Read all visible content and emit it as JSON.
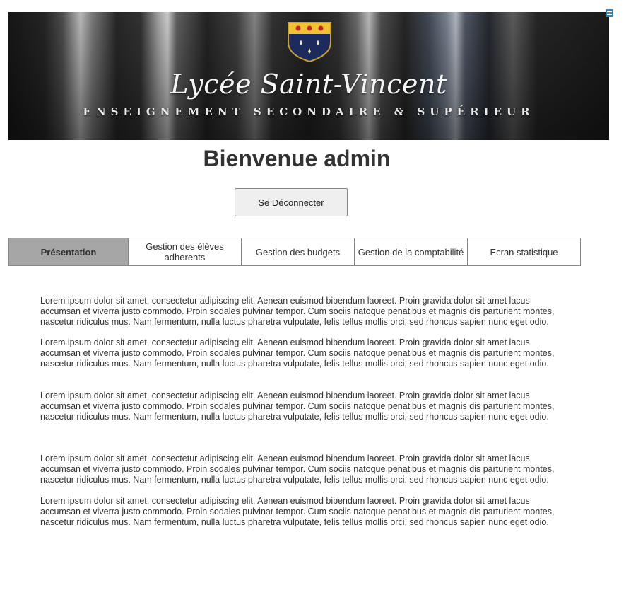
{
  "banner": {
    "title": "Lycée Saint-Vincent",
    "subtitle": "ENSEIGNEMENT SECONDAIRE & SUPÉRIEUR",
    "crest_colors": {
      "top": "#f2c230",
      "bottom": "#1c2a5e",
      "accent": "#c0272d"
    }
  },
  "welcome": "Bienvenue admin",
  "logout_label": "Se Déconnecter",
  "tabs": [
    {
      "label": "Présentation",
      "active": true
    },
    {
      "label": "Gestion des élèves adherents",
      "active": false
    },
    {
      "label": "Gestion des budgets",
      "active": false
    },
    {
      "label": "Gestion de la comptabilité",
      "active": false
    },
    {
      "label": "Ecran statistique",
      "active": false
    }
  ],
  "paragraphs": [
    "Lorem ipsum dolor sit amet, consectetur adipiscing elit. Aenean euismod bibendum laoreet. Proin gravida dolor sit amet lacus accumsan et viverra justo commodo. Proin sodales pulvinar tempor. Cum sociis natoque penatibus et magnis dis parturient montes, nascetur ridiculus mus. Nam fermentum, nulla luctus pharetra vulputate, felis tellus mollis orci, sed rhoncus sapien nunc eget odio.",
    "Lorem ipsum dolor sit amet, consectetur adipiscing elit. Aenean euismod bibendum laoreet. Proin gravida dolor sit amet lacus accumsan et viverra justo commodo. Proin sodales pulvinar tempor. Cum sociis natoque penatibus et magnis dis parturient montes, nascetur ridiculus mus. Nam fermentum, nulla luctus pharetra vulputate, felis tellus mollis orci, sed rhoncus sapien nunc eget odio.",
    "Lorem ipsum dolor sit amet, consectetur adipiscing elit. Aenean euismod bibendum laoreet. Proin gravida dolor sit amet lacus accumsan et viverra justo commodo. Proin sodales pulvinar tempor. Cum sociis natoque penatibus et magnis dis parturient montes, nascetur ridiculus mus. Nam fermentum, nulla luctus pharetra vulputate, felis tellus mollis orci, sed rhoncus sapien nunc eget odio.",
    "Lorem ipsum dolor sit amet, consectetur adipiscing elit. Aenean euismod bibendum laoreet. Proin gravida dolor sit amet lacus accumsan et viverra justo commodo. Proin sodales pulvinar tempor. Cum sociis natoque penatibus et magnis dis parturient montes, nascetur ridiculus mus. Nam fermentum, nulla luctus pharetra vulputate, felis tellus mollis orci, sed rhoncus sapien nunc eget odio.",
    "Lorem ipsum dolor sit amet, consectetur adipiscing elit. Aenean euismod bibendum laoreet. Proin gravida dolor sit amet lacus accumsan et viverra justo commodo. Proin sodales pulvinar tempor. Cum sociis natoque penatibus et magnis dis parturient montes, nascetur ridiculus mus. Nam fermentum, nulla luctus pharetra vulputate, felis tellus mollis orci, sed rhoncus sapien nunc eget odio."
  ],
  "icons": {
    "corner": "note-icon",
    "crest": "crest-icon"
  }
}
